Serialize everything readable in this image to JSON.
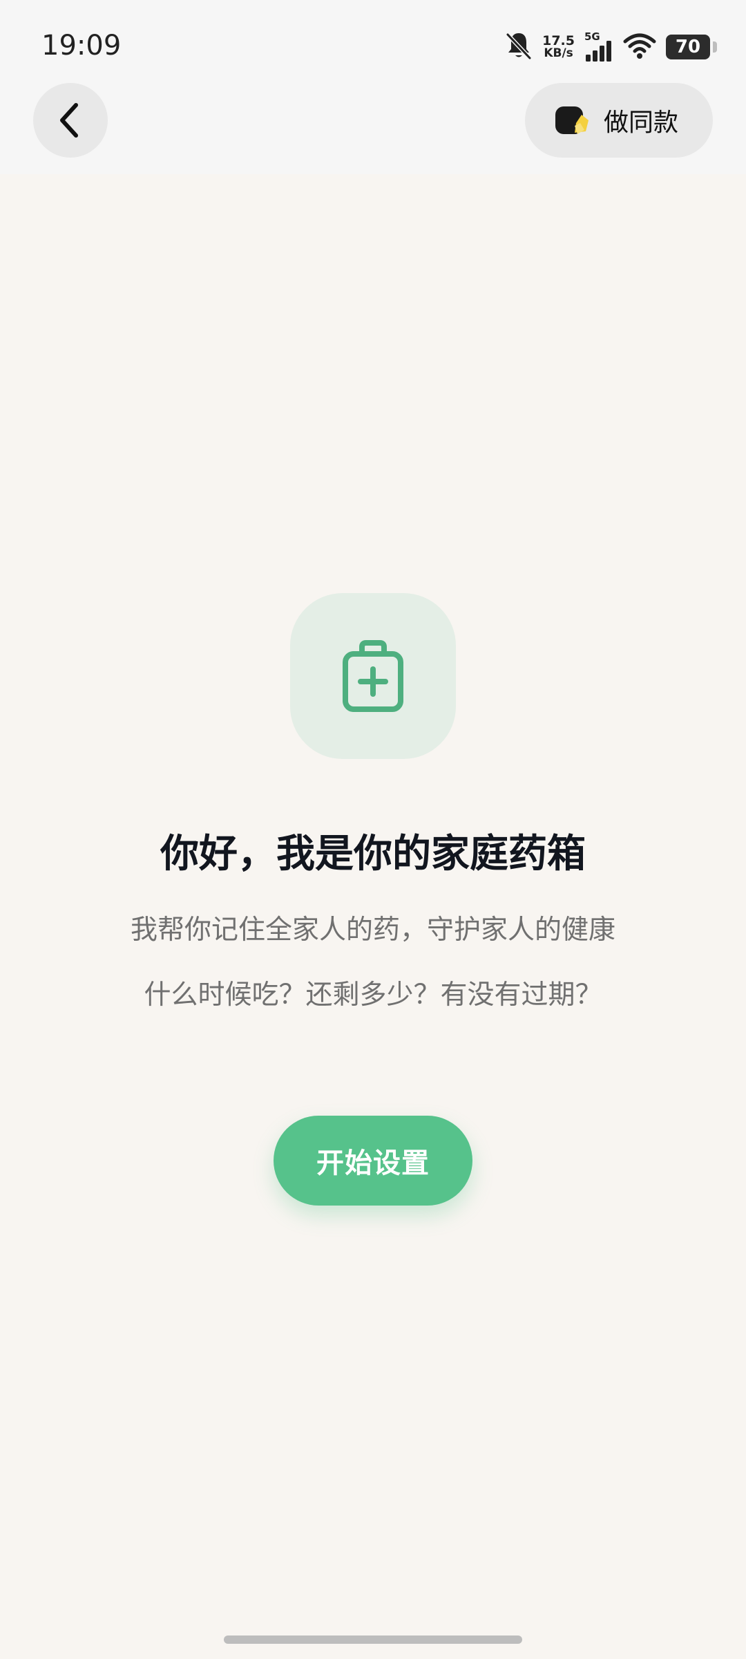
{
  "status_bar": {
    "time": "19:09",
    "speed_value": "17.5",
    "speed_unit": "KB/s",
    "network": "5G",
    "battery_level": "70",
    "icons": [
      "bell-muted-icon",
      "signal-icon",
      "wifi-icon",
      "battery-icon"
    ]
  },
  "header": {
    "back_icon": "chevron-left-icon",
    "make_same_label": "做同款",
    "make_same_icon": "sticker-icon"
  },
  "main": {
    "hero_icon": "medical-bag-icon",
    "title": "你好，我是你的家庭药箱",
    "subtitle_line1": "我帮你记住全家人的药，守护家人的健康",
    "subtitle_line2": "什么时候吃？还剩多少？有没有过期？",
    "start_button_label": "开始设置"
  },
  "colors": {
    "accent_green": "#56c28b",
    "icon_green": "#4eaf7f",
    "background": "#f8f5f1",
    "title_text": "#12161f",
    "subtitle_text": "#707070"
  }
}
